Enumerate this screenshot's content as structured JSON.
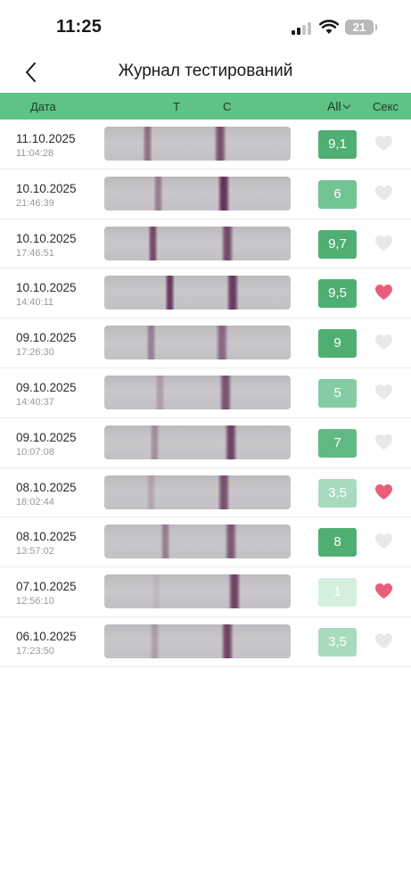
{
  "status_bar": {
    "time": "11:25",
    "battery": "21"
  },
  "nav": {
    "title": "Журнал тестирований",
    "back_icon": "chevron-left-icon"
  },
  "header": {
    "date": "Дата",
    "t": "T",
    "c": "C",
    "filter": "All",
    "sex": "Секс"
  },
  "colors": {
    "header_bg": "#5fc286",
    "heart_active": "#ea5d7b",
    "heart_inactive": "#e8e8e8",
    "line": "#6b3a5e"
  },
  "rows": [
    {
      "date": "11.10.2025",
      "time": "11:04:28",
      "score": "9,1",
      "score_color": "#4fae72",
      "sex": false,
      "t_pos": 0.23,
      "t_int": 0.55,
      "c_pos": 0.62,
      "c_int": 0.75
    },
    {
      "date": "10.10.2025",
      "time": "21:46:39",
      "score": "6",
      "score_color": "#72c495",
      "sex": false,
      "t_pos": 0.29,
      "t_int": 0.45,
      "c_pos": 0.64,
      "c_int": 0.95
    },
    {
      "date": "10.10.2025",
      "time": "17:46:51",
      "score": "9,7",
      "score_color": "#4fae72",
      "sex": false,
      "t_pos": 0.26,
      "t_int": 0.8,
      "c_pos": 0.66,
      "c_int": 0.8
    },
    {
      "date": "10.10.2025",
      "time": "14:40:11",
      "score": "9,5",
      "score_color": "#4fae72",
      "sex": true,
      "t_pos": 0.35,
      "t_int": 0.9,
      "c_pos": 0.69,
      "c_int": 0.9
    },
    {
      "date": "09.10.2025",
      "time": "17:26:30",
      "score": "9",
      "score_color": "#4fae72",
      "sex": false,
      "t_pos": 0.25,
      "t_int": 0.45,
      "c_pos": 0.63,
      "c_int": 0.6
    },
    {
      "date": "09.10.2025",
      "time": "14:40:37",
      "score": "5",
      "score_color": "#85cca4",
      "sex": false,
      "t_pos": 0.3,
      "t_int": 0.25,
      "c_pos": 0.65,
      "c_int": 0.75
    },
    {
      "date": "09.10.2025",
      "time": "10:07:08",
      "score": "7",
      "score_color": "#5fba83",
      "sex": false,
      "t_pos": 0.27,
      "t_int": 0.35,
      "c_pos": 0.68,
      "c_int": 0.85
    },
    {
      "date": "08.10.2025",
      "time": "18:02:44",
      "score": "3,5",
      "score_color": "#a8dbbd",
      "sex": true,
      "t_pos": 0.25,
      "t_int": 0.2,
      "c_pos": 0.64,
      "c_int": 0.75
    },
    {
      "date": "08.10.2025",
      "time": "13:57:02",
      "score": "8",
      "score_color": "#4fae72",
      "sex": false,
      "t_pos": 0.33,
      "t_int": 0.45,
      "c_pos": 0.68,
      "c_int": 0.7
    },
    {
      "date": "07.10.2025",
      "time": "12:56:10",
      "score": "1",
      "score_color": "#d5efdf",
      "sex": true,
      "t_pos": 0.28,
      "t_int": 0.06,
      "c_pos": 0.7,
      "c_int": 0.85
    },
    {
      "date": "06.10.2025",
      "time": "17:23:50",
      "score": "3,5",
      "score_color": "#a8dbbd",
      "sex": false,
      "t_pos": 0.27,
      "t_int": 0.25,
      "c_pos": 0.66,
      "c_int": 0.85
    }
  ]
}
